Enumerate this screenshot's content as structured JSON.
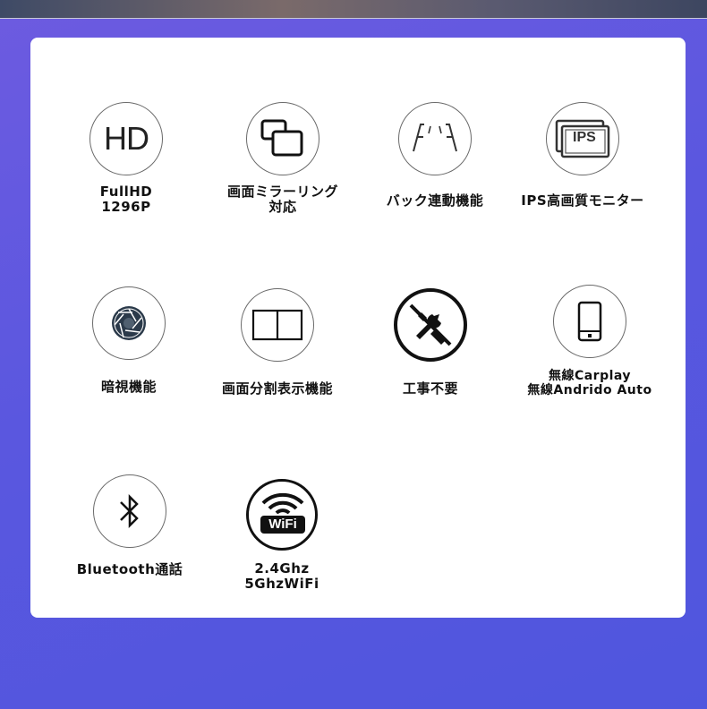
{
  "features": [
    {
      "label": "FullHD\n1296P",
      "icon": "hd-icon",
      "icon_text": "HD"
    },
    {
      "label": "画面ミラーリング\n対応",
      "icon": "screen-mirroring-icon"
    },
    {
      "label": "バック連動機能",
      "icon": "rear-camera-lines-icon"
    },
    {
      "label": "IPS高画質モニター",
      "icon": "ips-monitor-icon",
      "icon_text": "IPS"
    },
    {
      "label": "暗視機能",
      "icon": "night-vision-aperture-icon"
    },
    {
      "label": "画面分割表示機能",
      "icon": "split-screen-icon"
    },
    {
      "label": "工事不要",
      "icon": "no-installation-tools-icon"
    },
    {
      "label": "無線Carplay\n無線Andrido Auto",
      "icon": "smartphone-icon"
    },
    {
      "label": "Bluetooth通話",
      "icon": "bluetooth-icon"
    },
    {
      "label": "2.4Ghz\n5GhzWiFi",
      "icon": "wifi-icon",
      "icon_text": "WiFi"
    }
  ],
  "colors": {
    "background": "#5a57df",
    "panel": "#ffffff",
    "text": "#111111"
  }
}
